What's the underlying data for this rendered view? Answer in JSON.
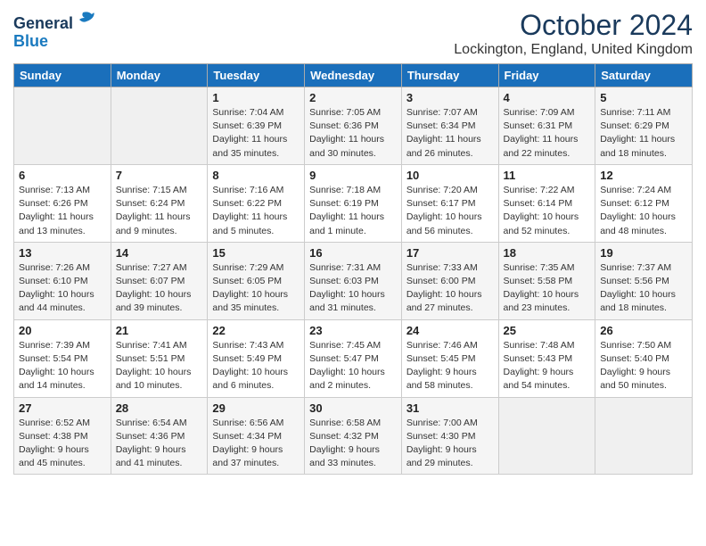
{
  "header": {
    "logo_general": "General",
    "logo_blue": "Blue",
    "month_title": "October 2024",
    "location": "Lockington, England, United Kingdom"
  },
  "days_of_week": [
    "Sunday",
    "Monday",
    "Tuesday",
    "Wednesday",
    "Thursday",
    "Friday",
    "Saturday"
  ],
  "weeks": [
    [
      {
        "day": "",
        "info": ""
      },
      {
        "day": "",
        "info": ""
      },
      {
        "day": "1",
        "info": "Sunrise: 7:04 AM\nSunset: 6:39 PM\nDaylight: 11 hours and 35 minutes."
      },
      {
        "day": "2",
        "info": "Sunrise: 7:05 AM\nSunset: 6:36 PM\nDaylight: 11 hours and 30 minutes."
      },
      {
        "day": "3",
        "info": "Sunrise: 7:07 AM\nSunset: 6:34 PM\nDaylight: 11 hours and 26 minutes."
      },
      {
        "day": "4",
        "info": "Sunrise: 7:09 AM\nSunset: 6:31 PM\nDaylight: 11 hours and 22 minutes."
      },
      {
        "day": "5",
        "info": "Sunrise: 7:11 AM\nSunset: 6:29 PM\nDaylight: 11 hours and 18 minutes."
      }
    ],
    [
      {
        "day": "6",
        "info": "Sunrise: 7:13 AM\nSunset: 6:26 PM\nDaylight: 11 hours and 13 minutes."
      },
      {
        "day": "7",
        "info": "Sunrise: 7:15 AM\nSunset: 6:24 PM\nDaylight: 11 hours and 9 minutes."
      },
      {
        "day": "8",
        "info": "Sunrise: 7:16 AM\nSunset: 6:22 PM\nDaylight: 11 hours and 5 minutes."
      },
      {
        "day": "9",
        "info": "Sunrise: 7:18 AM\nSunset: 6:19 PM\nDaylight: 11 hours and 1 minute."
      },
      {
        "day": "10",
        "info": "Sunrise: 7:20 AM\nSunset: 6:17 PM\nDaylight: 10 hours and 56 minutes."
      },
      {
        "day": "11",
        "info": "Sunrise: 7:22 AM\nSunset: 6:14 PM\nDaylight: 10 hours and 52 minutes."
      },
      {
        "day": "12",
        "info": "Sunrise: 7:24 AM\nSunset: 6:12 PM\nDaylight: 10 hours and 48 minutes."
      }
    ],
    [
      {
        "day": "13",
        "info": "Sunrise: 7:26 AM\nSunset: 6:10 PM\nDaylight: 10 hours and 44 minutes."
      },
      {
        "day": "14",
        "info": "Sunrise: 7:27 AM\nSunset: 6:07 PM\nDaylight: 10 hours and 39 minutes."
      },
      {
        "day": "15",
        "info": "Sunrise: 7:29 AM\nSunset: 6:05 PM\nDaylight: 10 hours and 35 minutes."
      },
      {
        "day": "16",
        "info": "Sunrise: 7:31 AM\nSunset: 6:03 PM\nDaylight: 10 hours and 31 minutes."
      },
      {
        "day": "17",
        "info": "Sunrise: 7:33 AM\nSunset: 6:00 PM\nDaylight: 10 hours and 27 minutes."
      },
      {
        "day": "18",
        "info": "Sunrise: 7:35 AM\nSunset: 5:58 PM\nDaylight: 10 hours and 23 minutes."
      },
      {
        "day": "19",
        "info": "Sunrise: 7:37 AM\nSunset: 5:56 PM\nDaylight: 10 hours and 18 minutes."
      }
    ],
    [
      {
        "day": "20",
        "info": "Sunrise: 7:39 AM\nSunset: 5:54 PM\nDaylight: 10 hours and 14 minutes."
      },
      {
        "day": "21",
        "info": "Sunrise: 7:41 AM\nSunset: 5:51 PM\nDaylight: 10 hours and 10 minutes."
      },
      {
        "day": "22",
        "info": "Sunrise: 7:43 AM\nSunset: 5:49 PM\nDaylight: 10 hours and 6 minutes."
      },
      {
        "day": "23",
        "info": "Sunrise: 7:45 AM\nSunset: 5:47 PM\nDaylight: 10 hours and 2 minutes."
      },
      {
        "day": "24",
        "info": "Sunrise: 7:46 AM\nSunset: 5:45 PM\nDaylight: 9 hours and 58 minutes."
      },
      {
        "day": "25",
        "info": "Sunrise: 7:48 AM\nSunset: 5:43 PM\nDaylight: 9 hours and 54 minutes."
      },
      {
        "day": "26",
        "info": "Sunrise: 7:50 AM\nSunset: 5:40 PM\nDaylight: 9 hours and 50 minutes."
      }
    ],
    [
      {
        "day": "27",
        "info": "Sunrise: 6:52 AM\nSunset: 4:38 PM\nDaylight: 9 hours and 45 minutes."
      },
      {
        "day": "28",
        "info": "Sunrise: 6:54 AM\nSunset: 4:36 PM\nDaylight: 9 hours and 41 minutes."
      },
      {
        "day": "29",
        "info": "Sunrise: 6:56 AM\nSunset: 4:34 PM\nDaylight: 9 hours and 37 minutes."
      },
      {
        "day": "30",
        "info": "Sunrise: 6:58 AM\nSunset: 4:32 PM\nDaylight: 9 hours and 33 minutes."
      },
      {
        "day": "31",
        "info": "Sunrise: 7:00 AM\nSunset: 4:30 PM\nDaylight: 9 hours and 29 minutes."
      },
      {
        "day": "",
        "info": ""
      },
      {
        "day": "",
        "info": ""
      }
    ]
  ]
}
